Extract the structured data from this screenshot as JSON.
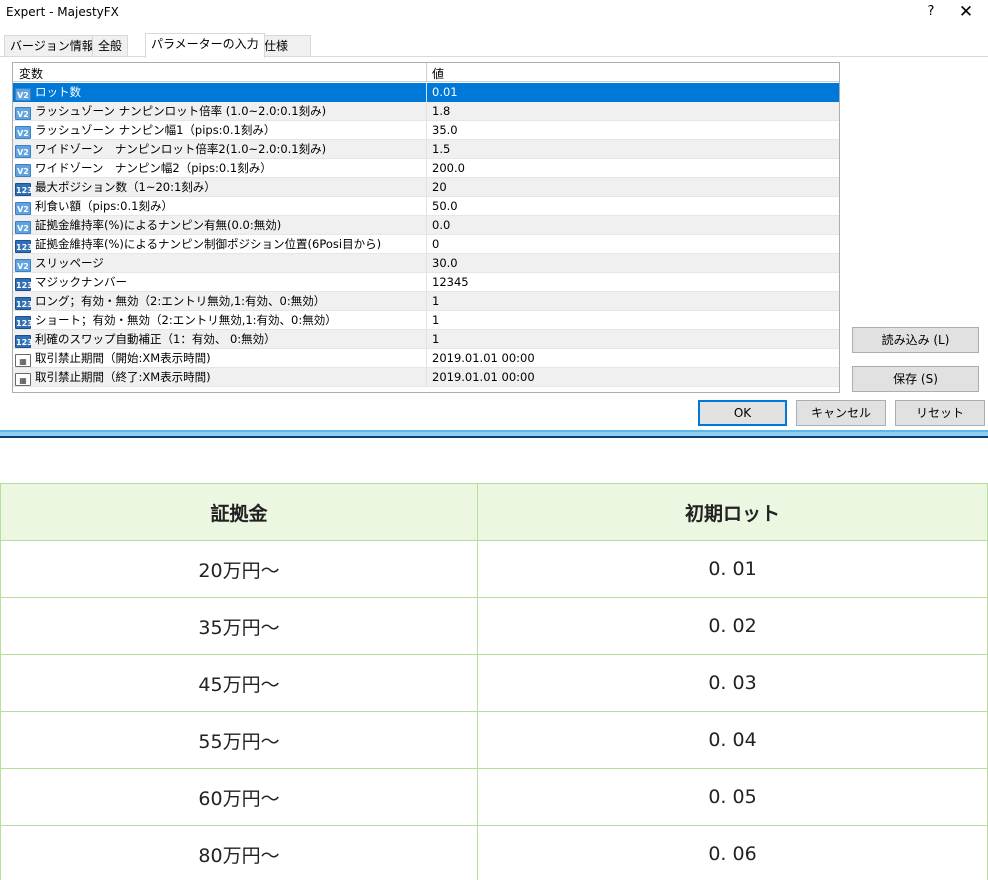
{
  "window": {
    "title": "Expert - MajestyFX",
    "help": "?",
    "close": "✕"
  },
  "tabs": [
    {
      "label": "バージョン情報"
    },
    {
      "label": "全般"
    },
    {
      "label": "パラメーターの入力"
    },
    {
      "label": "仕様"
    }
  ],
  "grid": {
    "col_variable": "変数",
    "col_value": "値",
    "rows": [
      {
        "icon": "v2",
        "name": "ロット数",
        "value": "0.01"
      },
      {
        "icon": "v2",
        "name": "ラッシュゾーン ナンピンロット倍率 (1.0~2.0:0.1刻み)",
        "value": "1.8"
      },
      {
        "icon": "v2",
        "name": "ラッシュゾーン ナンピン幅1（pips:0.1刻み）",
        "value": "35.0"
      },
      {
        "icon": "v2",
        "name": "ワイドゾーン　ナンピンロット倍率2(1.0~2.0:0.1刻み)",
        "value": "1.5"
      },
      {
        "icon": "v2",
        "name": "ワイドゾーン　ナンピン幅2（pips:0.1刻み）",
        "value": "200.0"
      },
      {
        "icon": "123",
        "name": "最大ポジション数（1~20:1刻み）",
        "value": "20"
      },
      {
        "icon": "v2",
        "name": "利食い額（pips:0.1刻み）",
        "value": "50.0"
      },
      {
        "icon": "v2",
        "name": "証拠金維持率(%)によるナンピン有無(0.0:無効)",
        "value": "0.0"
      },
      {
        "icon": "123",
        "name": "証拠金維持率(%)によるナンピン制御ポジション位置(6Posi目から)",
        "value": "0"
      },
      {
        "icon": "v2",
        "name": "スリッページ",
        "value": "30.0"
      },
      {
        "icon": "123",
        "name": "マジックナンバー",
        "value": "12345"
      },
      {
        "icon": "123",
        "name": "ロング；有効・無効（2:エントリ無効,1:有効、0:無効）",
        "value": "1"
      },
      {
        "icon": "123",
        "name": "ショート；有効・無効（2:エントリ無効,1:有効、0:無効）",
        "value": "1"
      },
      {
        "icon": "123",
        "name": "利確のスワップ自動補正（1：有効、 0:無効）",
        "value": "1"
      },
      {
        "icon": "calendar",
        "name": "取引禁止期間（開始:XM表示時間)",
        "value": "2019.01.01 00:00"
      },
      {
        "icon": "calendar",
        "name": "取引禁止期間（終了:XM表示時間)",
        "value": "2019.01.01 00:00"
      }
    ]
  },
  "buttons": {
    "load": "読み込み (L)",
    "save": "保存 (S)",
    "ok": "OK",
    "cancel": "キャンセル",
    "reset": "リセット"
  },
  "deposit_table": {
    "headers": [
      "証拠金",
      "初期ロット"
    ],
    "rows": [
      [
        "20万円～",
        "0. 01"
      ],
      [
        "35万円～",
        "0. 02"
      ],
      [
        "45万円～",
        "0. 03"
      ],
      [
        "55万円～",
        "0. 04"
      ],
      [
        "60万円～",
        "0. 05"
      ],
      [
        "80万円～",
        "0. 06"
      ]
    ]
  },
  "colors": {
    "selection": "#0078d7",
    "table_border": "#b5df9b",
    "table_header_bg": "#ecf7e2"
  }
}
